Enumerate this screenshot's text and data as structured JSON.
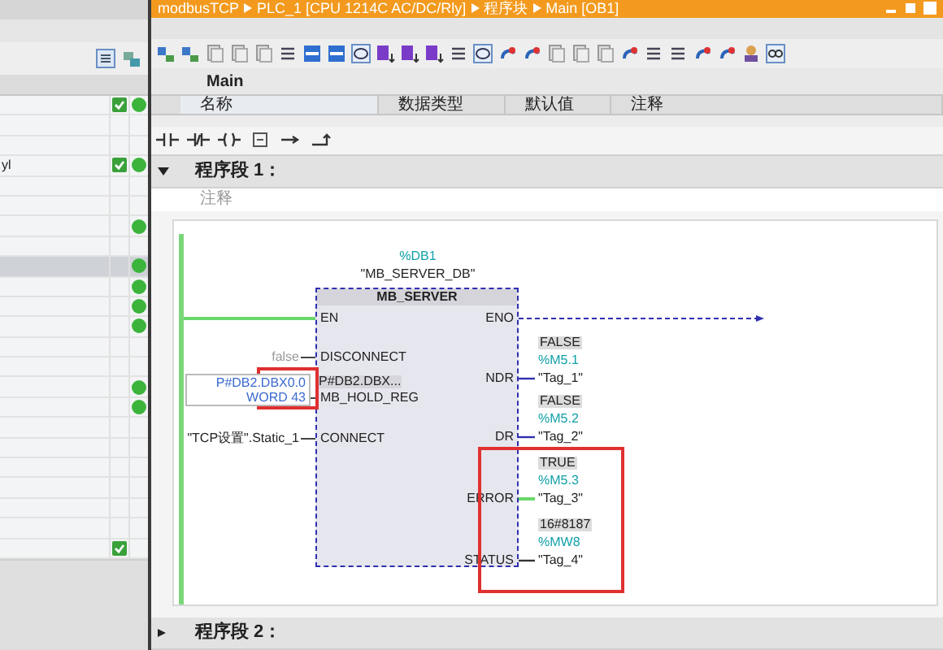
{
  "left_panel": {
    "rows": [
      {
        "check": true,
        "dot": true,
        "selected": false
      },
      {
        "check": false,
        "dot": false,
        "selected": false
      },
      {
        "check": false,
        "dot": false,
        "selected": false
      },
      {
        "text": "yl",
        "check": true,
        "dot": true,
        "selected": false
      },
      {
        "check": false,
        "dot": false,
        "selected": false
      },
      {
        "check": false,
        "dot": false,
        "selected": false
      },
      {
        "check": false,
        "dot": true,
        "selected": false
      },
      {
        "check": false,
        "dot": false,
        "selected": false
      },
      {
        "check": false,
        "dot": true,
        "selected": true
      },
      {
        "check": false,
        "dot": true,
        "selected": false
      },
      {
        "check": false,
        "dot": true,
        "selected": false
      },
      {
        "check": false,
        "dot": true,
        "selected": false
      },
      {
        "check": false,
        "dot": false,
        "selected": false
      },
      {
        "check": false,
        "dot": false,
        "selected": false
      },
      {
        "check": false,
        "dot": true,
        "selected": false
      },
      {
        "check": false,
        "dot": true,
        "selected": false
      },
      {
        "check": false,
        "dot": false,
        "selected": false
      },
      {
        "check": false,
        "dot": false,
        "selected": false
      },
      {
        "check": false,
        "dot": false,
        "selected": false
      },
      {
        "check": false,
        "dot": false,
        "selected": false
      },
      {
        "check": false,
        "dot": false,
        "selected": false
      },
      {
        "check": false,
        "dot": false,
        "selected": false
      },
      {
        "check": true,
        "dot": false,
        "selected": false
      }
    ]
  },
  "editor": {
    "breadcrumb": [
      "modbusTCP",
      "PLC_1 [CPU 1214C AC/DC/Rly]",
      "程序块",
      "Main [OB1]"
    ],
    "interface": {
      "title": "Main",
      "columns": [
        "名称",
        "数据类型",
        "默认值",
        "注释"
      ]
    },
    "networks": [
      {
        "title": "程序段 1：",
        "expanded": true,
        "comment": "注释",
        "block": {
          "instance": "%DB1",
          "instance_name": "\"MB_SERVER_DB\"",
          "name": "MB_SERVER",
          "inputs": [
            {
              "pin": "EN",
              "powered": true,
              "highlighted": false
            },
            {
              "pin": "DISCONNECT",
              "value": [
                "false"
              ],
              "powered": false,
              "highlighted": false
            },
            {
              "pin": "MB_HOLD_REG",
              "inner": "P#DB2.DBX...",
              "value": [
                "P#DB2.DBX0.0",
                "WORD 43"
              ],
              "powered": false,
              "highlighted": true
            },
            {
              "pin": "CONNECT",
              "value": [
                "\"TCP设置\".Static_1"
              ],
              "powered": false,
              "highlighted": false
            }
          ],
          "outputs": [
            {
              "pin": "ENO",
              "powered": false,
              "highlighted": false
            },
            {
              "pin": "NDR",
              "value": "FALSE",
              "address": "%M5.1",
              "tag": "\"Tag_1\"",
              "powered": false,
              "highlighted": false
            },
            {
              "pin": "DR",
              "value": "FALSE",
              "address": "%M5.2",
              "tag": "\"Tag_2\"",
              "powered": false,
              "highlighted": false
            },
            {
              "pin": "ERROR",
              "value": "TRUE",
              "address": "%M5.3",
              "tag": "\"Tag_3\"",
              "powered": true,
              "highlighted": true
            },
            {
              "pin": "STATUS",
              "value": "16#8187",
              "address": "%MW8",
              "tag": "\"Tag_4\"",
              "powered": false,
              "highlighted": true
            }
          ]
        }
      },
      {
        "title": "程序段 2：",
        "expanded": false
      }
    ]
  }
}
